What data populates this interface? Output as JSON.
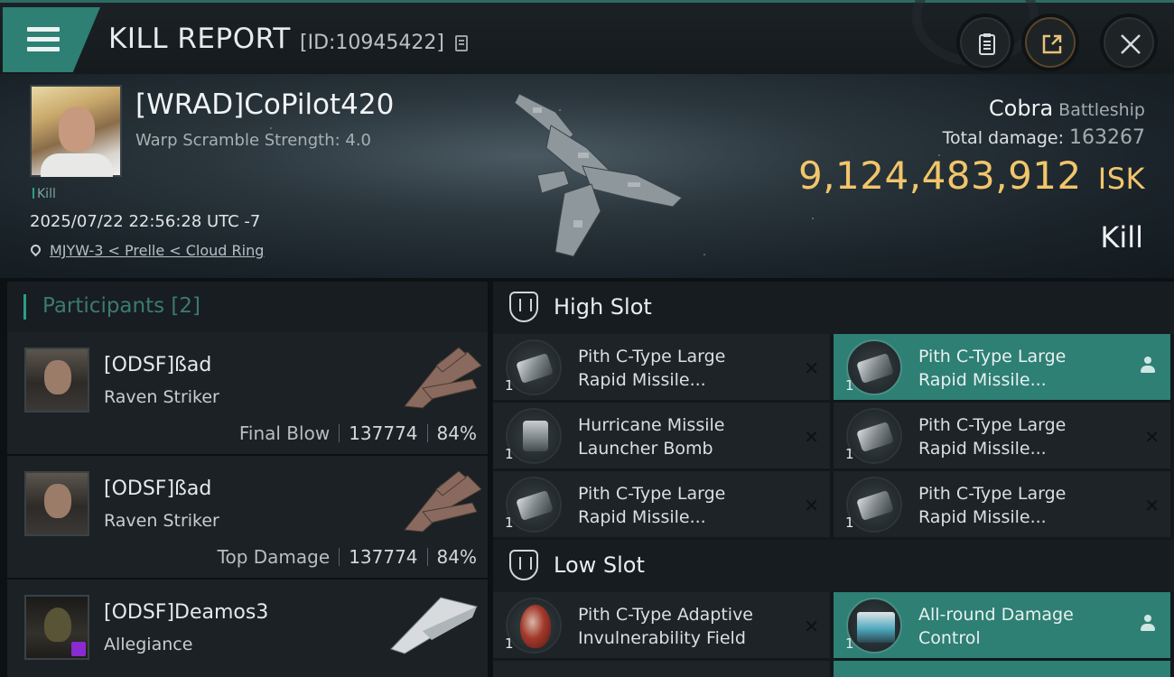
{
  "header": {
    "title": "KILL REPORT",
    "report_id": "[ID:10945422]"
  },
  "victim": {
    "name": "[WRAD]CoPilot420",
    "warp_scramble": "Warp Scramble Strength: 4.0",
    "kill_tag": "Kill",
    "timestamp": "2025/07/22 22:56:28 UTC -7",
    "location": "MJYW-3 < Prelle < Cloud Ring",
    "ship_name": "Cobra",
    "ship_class": "Battleship",
    "total_damage_label": "Total damage:",
    "total_damage_value": "163267",
    "isk_value": "9,124,483,912",
    "isk_unit": "ISK",
    "kill_type": "Kill"
  },
  "participants": {
    "header_label": "Participants",
    "header_count": "[2]",
    "rows": [
      {
        "name": "[ODSF]ßad",
        "ship": "Raven Striker",
        "role": "Final Blow",
        "damage": "137774",
        "percent": "84%"
      },
      {
        "name": "[ODSF]ßad",
        "ship": "Raven Striker",
        "role": "Top Damage",
        "damage": "137774",
        "percent": "84%"
      },
      {
        "name": "[ODSF]Deamos3",
        "ship": "Allegiance",
        "role": "",
        "damage": "",
        "percent": ""
      }
    ]
  },
  "fitting": {
    "high_slot_label": "High Slot",
    "low_slot_label": "Low Slot",
    "high_modules": [
      {
        "qty": "1",
        "line1": "Pith C-Type Large",
        "line2": "Rapid Missile...",
        "status": "destroyed"
      },
      {
        "qty": "1",
        "line1": "Pith C-Type Large",
        "line2": "Rapid Missile...",
        "status": "dropped"
      },
      {
        "qty": "1",
        "line1": "Hurricane Missile",
        "line2": "Launcher Bomb",
        "status": "destroyed"
      },
      {
        "qty": "1",
        "line1": "Pith C-Type Large",
        "line2": "Rapid Missile...",
        "status": "destroyed"
      },
      {
        "qty": "1",
        "line1": "Pith C-Type Large",
        "line2": "Rapid Missile...",
        "status": "destroyed"
      },
      {
        "qty": "1",
        "line1": "Pith C-Type Large",
        "line2": "Rapid Missile...",
        "status": "destroyed"
      }
    ],
    "low_modules": [
      {
        "qty": "1",
        "line1": "Pith C-Type Adaptive",
        "line2": "Invulnerability Field",
        "status": "destroyed"
      },
      {
        "qty": "1",
        "line1": "All-round Damage",
        "line2": "Control",
        "status": "dropped"
      }
    ]
  },
  "colors": {
    "accent": "#2e7f74",
    "isk_gold": "#f2c56b"
  }
}
